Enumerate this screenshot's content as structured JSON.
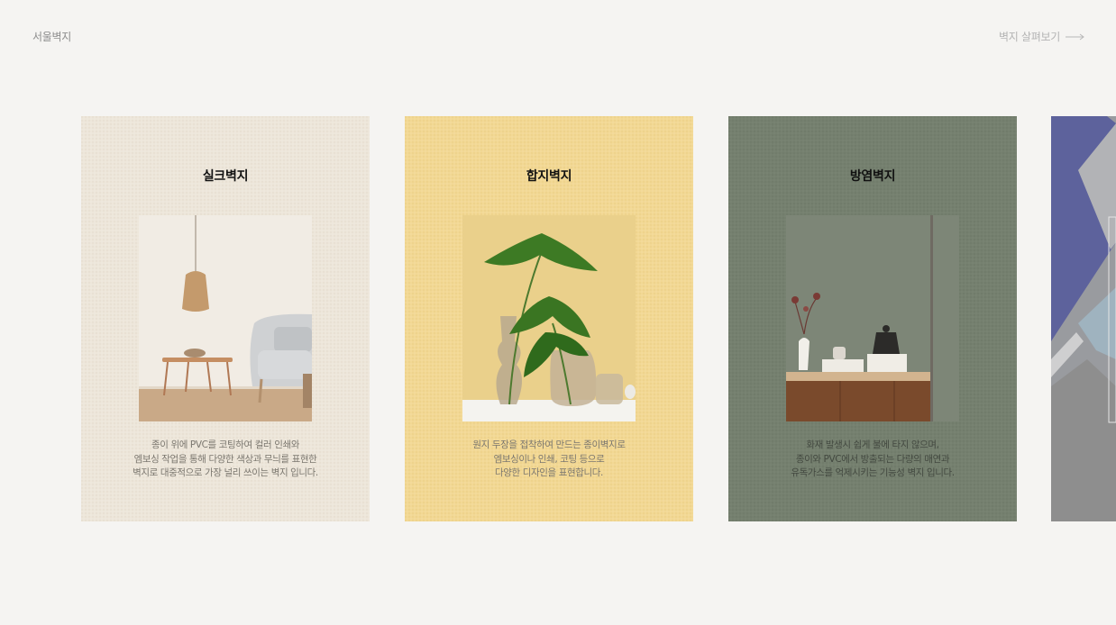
{
  "header": {
    "brand": "서울벽지",
    "view_all": "벽지 살펴보기"
  },
  "cards": [
    {
      "title": "실크벽지",
      "desc": [
        "종이 위에 PVC를 코팅하여 컬러 인쇄와",
        "엠보싱 작업을 통해 다양한 색상과 무늬를 표현한",
        "벽지로 대중적으로 가장 널리 쓰이는 벽지 입니다."
      ],
      "bg": "#ede6da"
    },
    {
      "title": "합지벽지",
      "desc": [
        "원지 두장을 접착하여 만드는 종이벽지로",
        "엠보싱이나 인쇄, 코팅 등으로",
        "다양한 디자인을 표현합니다."
      ],
      "bg": "#f2d894"
    },
    {
      "title": "방염벽지",
      "desc": [
        "화재 발생시 쉽게 불에 타지 않으며,",
        "종이와 PVC에서 방출되는 다량의 매연과",
        "유독가스를 억제시키는 기능성 벽지 입니다."
      ],
      "bg": "#75806f"
    }
  ],
  "colors": {
    "page_bg": "#f5f4f2",
    "brand_text": "#8d8d8d",
    "link_text": "#b3b3b3"
  },
  "icons": {
    "arrow": "arrow-right-icon"
  }
}
